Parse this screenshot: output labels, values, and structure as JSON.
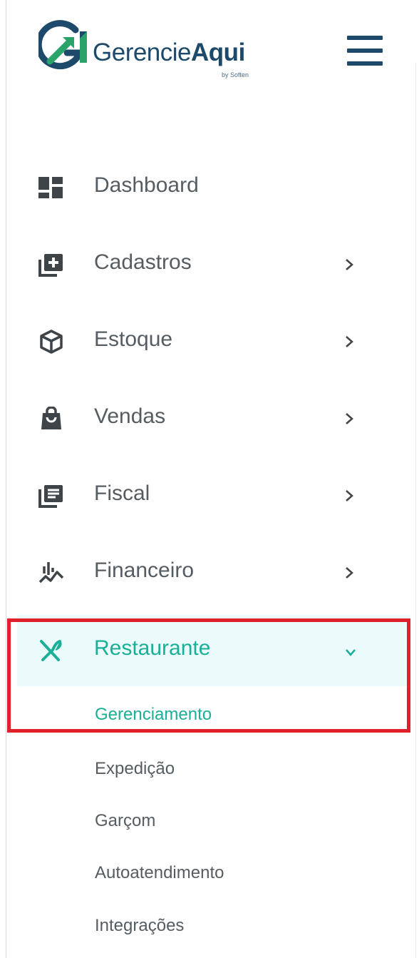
{
  "brand": {
    "name_regular": "Gerencie",
    "name_bold": "Aqui",
    "byline": "by Soften",
    "colors": {
      "navy": "#1d4a6b",
      "green": "#2aa36b"
    }
  },
  "header": {
    "menu_icon": "hamburger-icon"
  },
  "menu": {
    "items": [
      {
        "label": "Dashboard",
        "icon": "dashboard-icon"
      },
      {
        "label": "Cadastros",
        "icon": "add-library-icon"
      },
      {
        "label": "Estoque",
        "icon": "box-icon"
      },
      {
        "label": "Vendas",
        "icon": "shopping-bag-icon"
      },
      {
        "label": "Fiscal",
        "icon": "document-stack-icon"
      },
      {
        "label": "Financeiro",
        "icon": "finance-chart-icon"
      },
      {
        "label": "Restaurante",
        "icon": "fork-knife-icon",
        "expanded": true
      }
    ],
    "submenu": [
      {
        "label": "Gerenciamento",
        "active": true
      },
      {
        "label": "Expedição"
      },
      {
        "label": "Garçom"
      },
      {
        "label": "Autoatendimento"
      },
      {
        "label": "Integrações"
      }
    ]
  },
  "colors": {
    "text": "#555d63",
    "accent": "#1aaf97",
    "active_bg": "#ebfbfb",
    "highlight": "#e0202a"
  }
}
